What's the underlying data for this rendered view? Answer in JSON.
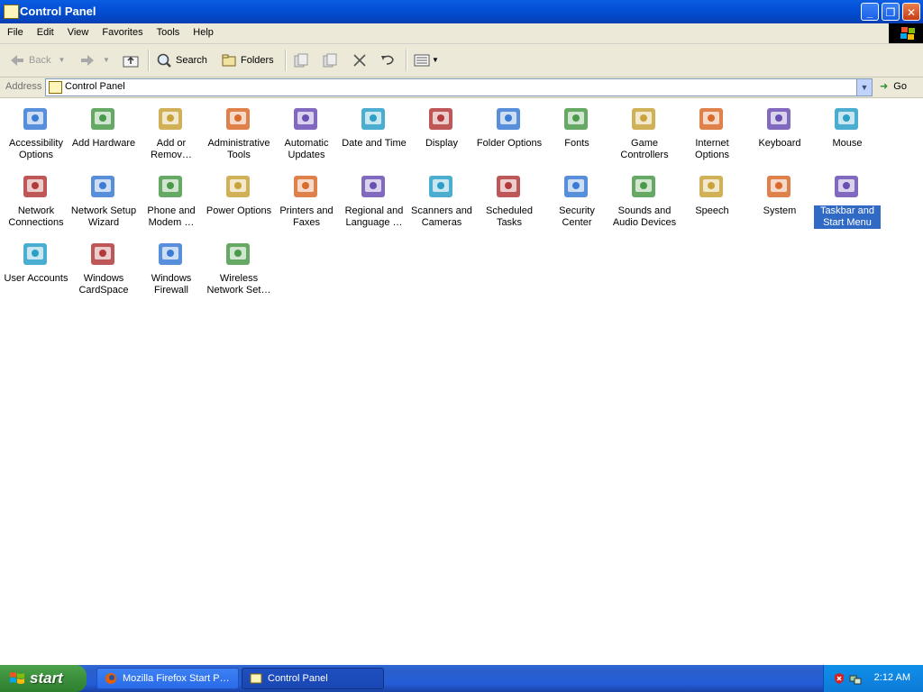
{
  "window": {
    "title": "Control Panel"
  },
  "menubar": {
    "items": [
      "File",
      "Edit",
      "View",
      "Favorites",
      "Tools",
      "Help"
    ]
  },
  "toolbar": {
    "back_label": "Back",
    "search_label": "Search",
    "folders_label": "Folders"
  },
  "address": {
    "label": "Address",
    "value": "Control Panel",
    "go_label": "Go"
  },
  "items": [
    {
      "name": "Accessibility Options",
      "l1": "Accessibility",
      "l2": "Options"
    },
    {
      "name": "Add Hardware",
      "l1": "Add Hardware",
      "l2": ""
    },
    {
      "name": "Add or Remove Programs",
      "l1": "Add or",
      "l2": "Remov…"
    },
    {
      "name": "Administrative Tools",
      "l1": "Administrative",
      "l2": "Tools"
    },
    {
      "name": "Automatic Updates",
      "l1": "Automatic",
      "l2": "Updates"
    },
    {
      "name": "Date and Time",
      "l1": "Date and Time",
      "l2": ""
    },
    {
      "name": "Display",
      "l1": "Display",
      "l2": ""
    },
    {
      "name": "Folder Options",
      "l1": "Folder Options",
      "l2": ""
    },
    {
      "name": "Fonts",
      "l1": "Fonts",
      "l2": ""
    },
    {
      "name": "Game Controllers",
      "l1": "Game",
      "l2": "Controllers"
    },
    {
      "name": "Internet Options",
      "l1": "Internet",
      "l2": "Options"
    },
    {
      "name": "Keyboard",
      "l1": "Keyboard",
      "l2": ""
    },
    {
      "name": "Mouse",
      "l1": "Mouse",
      "l2": ""
    },
    {
      "name": "Network Connections",
      "l1": "Network",
      "l2": "Connections"
    },
    {
      "name": "Network Setup Wizard",
      "l1": "Network Setup",
      "l2": "Wizard"
    },
    {
      "name": "Phone and Modem",
      "l1": "Phone and",
      "l2": "Modem …"
    },
    {
      "name": "Power Options",
      "l1": "Power Options",
      "l2": ""
    },
    {
      "name": "Printers and Faxes",
      "l1": "Printers and",
      "l2": "Faxes"
    },
    {
      "name": "Regional and Language",
      "l1": "Regional and",
      "l2": "Language …"
    },
    {
      "name": "Scanners and Cameras",
      "l1": "Scanners and",
      "l2": "Cameras"
    },
    {
      "name": "Scheduled Tasks",
      "l1": "Scheduled",
      "l2": "Tasks"
    },
    {
      "name": "Security Center",
      "l1": "Security",
      "l2": "Center"
    },
    {
      "name": "Sounds and Audio Devices",
      "l1": "Sounds and",
      "l2": "Audio Devices"
    },
    {
      "name": "Speech",
      "l1": "Speech",
      "l2": ""
    },
    {
      "name": "System",
      "l1": "System",
      "l2": ""
    },
    {
      "name": "Taskbar and Start Menu",
      "l1": "Taskbar and",
      "l2": "Start Menu",
      "selected": true
    },
    {
      "name": "User Accounts",
      "l1": "User Accounts",
      "l2": ""
    },
    {
      "name": "Windows CardSpace",
      "l1": "Windows",
      "l2": "CardSpace"
    },
    {
      "name": "Windows Firewall",
      "l1": "Windows",
      "l2": "Firewall"
    },
    {
      "name": "Wireless Network Setup",
      "l1": "Wireless",
      "l2": "Network Set…"
    }
  ],
  "taskbar": {
    "start_label": "start",
    "tasks": [
      {
        "label": "Mozilla Firefox Start P…",
        "icon": "firefox-icon"
      },
      {
        "label": "Control Panel",
        "icon": "control-panel-icon",
        "active": true
      }
    ],
    "clock": "2:12 AM"
  },
  "colors": {
    "titlebar": "#0553da",
    "selection": "#316ac5",
    "taskbar": "#245dd8",
    "start": "#3c8f3c"
  }
}
